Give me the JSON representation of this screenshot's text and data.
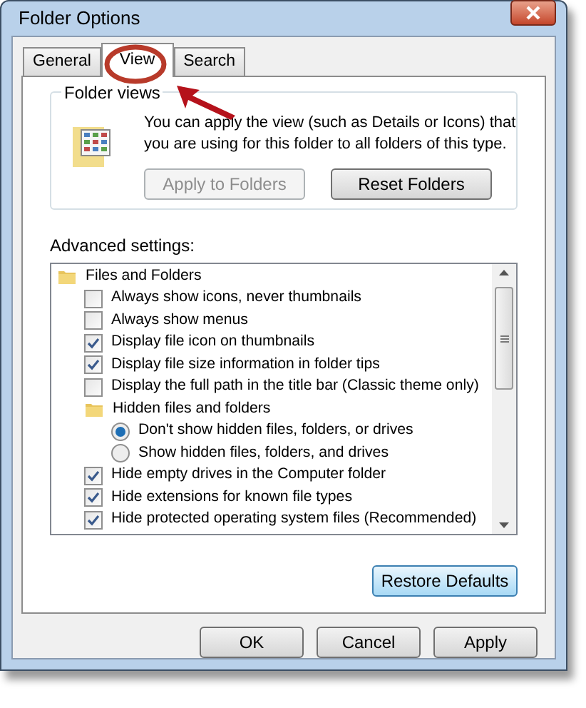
{
  "window": {
    "title": "Folder Options"
  },
  "tabs": [
    {
      "label": "General",
      "selected": false
    },
    {
      "label": "View",
      "selected": true
    },
    {
      "label": "Search",
      "selected": false
    }
  ],
  "folder_views": {
    "title": "Folder views",
    "description": "You can apply the view (such as Details or Icons) that you are using for this folder to all folders of this type.",
    "buttons": [
      {
        "label": "Apply to Folders",
        "disabled": true
      },
      {
        "label": "Reset Folders",
        "disabled": false
      }
    ]
  },
  "advanced": {
    "label": "Advanced settings:",
    "items": [
      {
        "kind": "folder",
        "label": "Files and Folders",
        "children": [
          {
            "kind": "checkbox",
            "label": "Always show icons, never thumbnails",
            "checked": false
          },
          {
            "kind": "checkbox",
            "label": "Always show menus",
            "checked": false
          },
          {
            "kind": "checkbox",
            "label": "Display file icon on thumbnails",
            "checked": true
          },
          {
            "kind": "checkbox",
            "label": "Display file size information in folder tips",
            "checked": true
          },
          {
            "kind": "checkbox",
            "label": "Display the full path in the title bar (Classic theme only)",
            "checked": false
          },
          {
            "kind": "folder",
            "label": "Hidden files and folders",
            "children": [
              {
                "kind": "radio",
                "label": "Don't show hidden files, folders, or drives",
                "selected": true
              },
              {
                "kind": "radio",
                "label": "Show hidden files, folders, and drives",
                "selected": false
              }
            ]
          },
          {
            "kind": "checkbox",
            "label": "Hide empty drives in the Computer folder",
            "checked": true
          },
          {
            "kind": "checkbox",
            "label": "Hide extensions for known file types",
            "checked": true
          },
          {
            "kind": "checkbox",
            "label": "Hide protected operating system files (Recommended)",
            "checked": true
          }
        ]
      }
    ]
  },
  "restore_button": "Restore Defaults",
  "buttons": [
    "OK",
    "Cancel",
    "Apply"
  ]
}
